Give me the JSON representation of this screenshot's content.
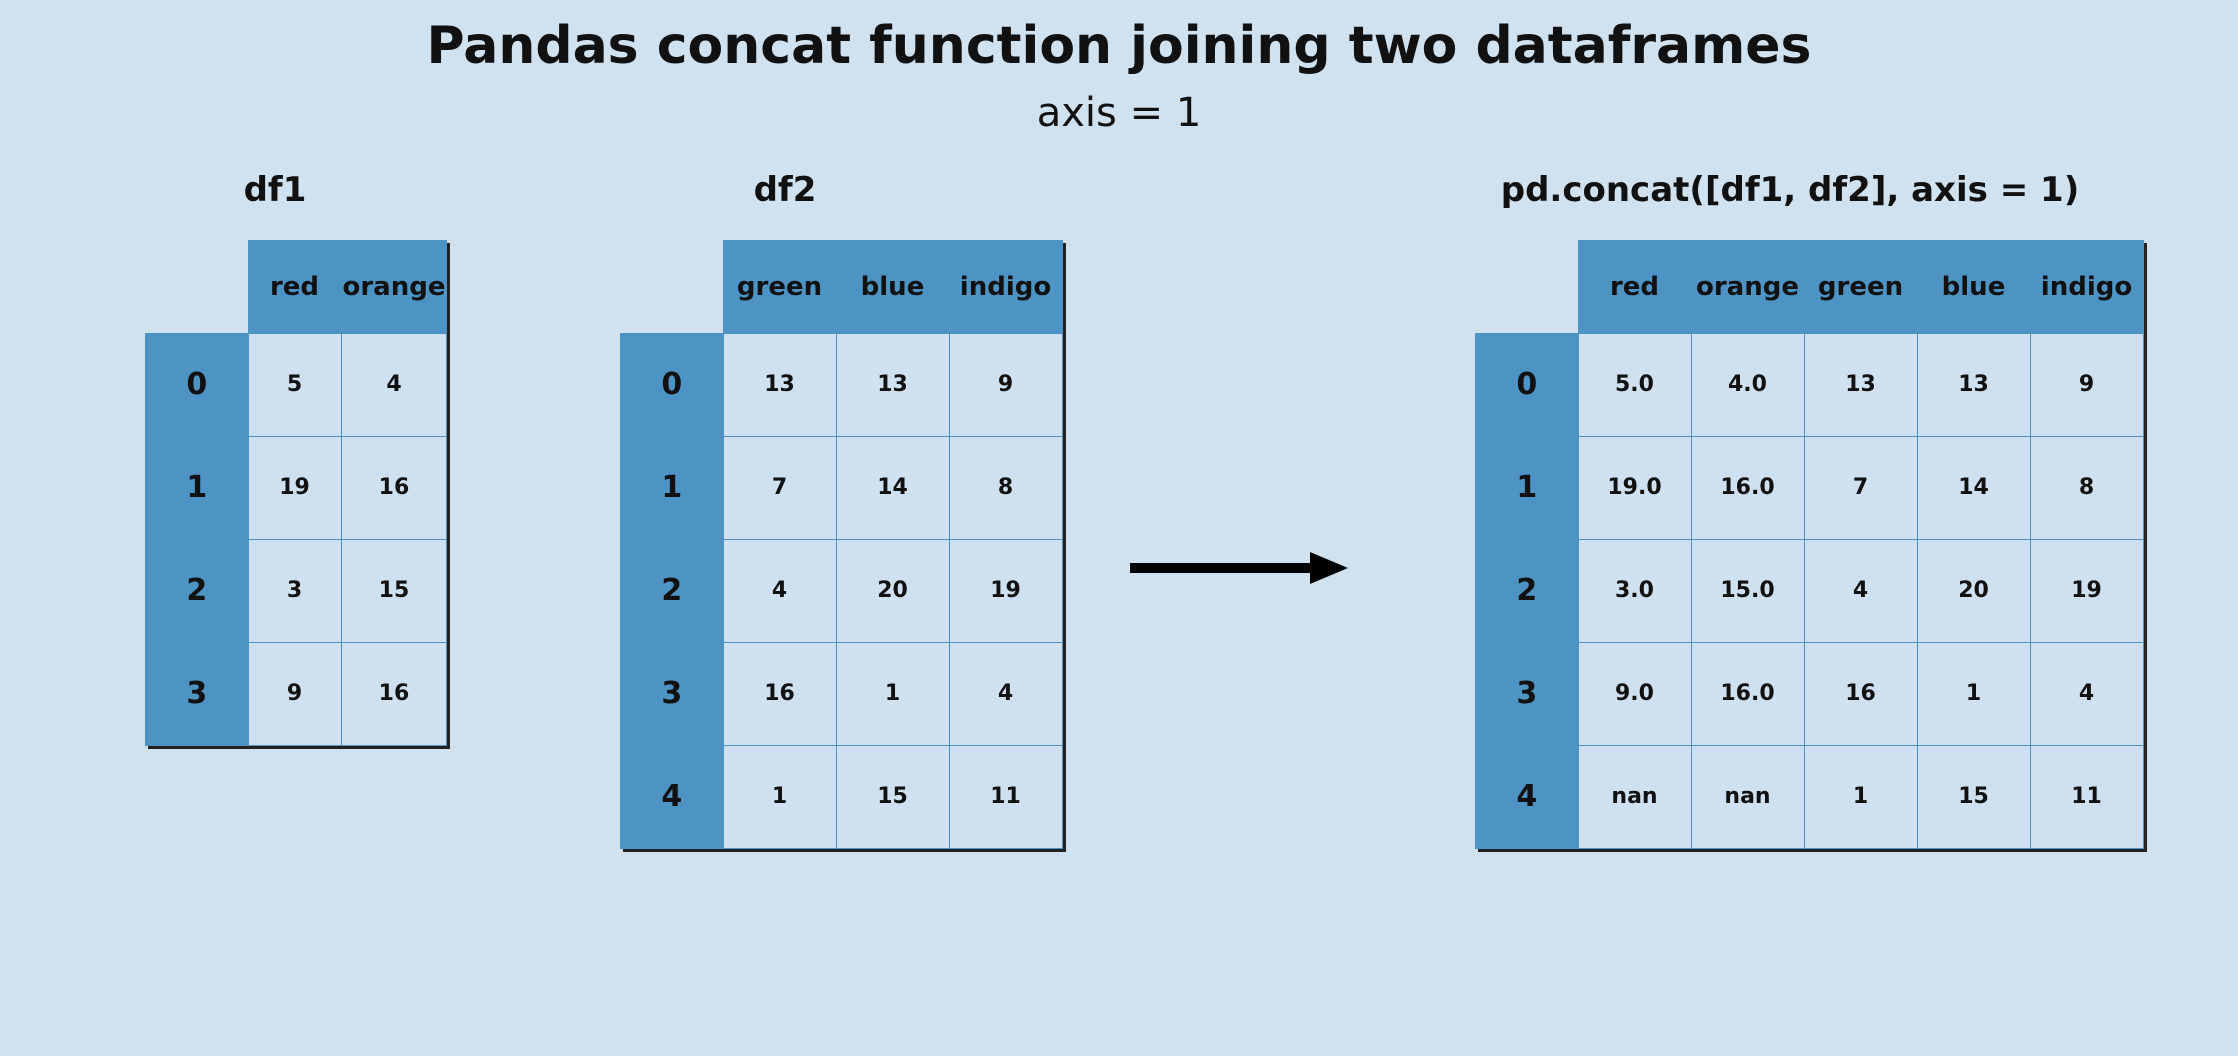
{
  "title": "Pandas concat function joining two dataframes",
  "subtitle": "axis = 1",
  "panels": {
    "df1": {
      "title": "df1"
    },
    "df2": {
      "title": "df2"
    },
    "result": {
      "title": "pd.concat([df1, df2], axis = 1)"
    }
  },
  "chart_data": [
    {
      "type": "table",
      "name": "df1",
      "columns": [
        "red",
        "orange"
      ],
      "index": [
        "0",
        "1",
        "2",
        "3"
      ],
      "values": [
        [
          "5",
          "4"
        ],
        [
          "19",
          "16"
        ],
        [
          "3",
          "15"
        ],
        [
          "9",
          "16"
        ]
      ]
    },
    {
      "type": "table",
      "name": "df2",
      "columns": [
        "green",
        "blue",
        "indigo"
      ],
      "index": [
        "0",
        "1",
        "2",
        "3",
        "4"
      ],
      "values": [
        [
          "13",
          "13",
          "9"
        ],
        [
          "7",
          "14",
          "8"
        ],
        [
          "4",
          "20",
          "19"
        ],
        [
          "16",
          "1",
          "4"
        ],
        [
          "1",
          "15",
          "11"
        ]
      ]
    },
    {
      "type": "table",
      "name": "result",
      "columns": [
        "red",
        "orange",
        "green",
        "blue",
        "indigo"
      ],
      "index": [
        "0",
        "1",
        "2",
        "3",
        "4"
      ],
      "values": [
        [
          "5.0",
          "4.0",
          "13",
          "13",
          "9"
        ],
        [
          "19.0",
          "16.0",
          "7",
          "14",
          "8"
        ],
        [
          "3.0",
          "15.0",
          "4",
          "20",
          "19"
        ],
        [
          "9.0",
          "16.0",
          "16",
          "1",
          "4"
        ],
        [
          "nan",
          "nan",
          "1",
          "15",
          "11"
        ]
      ]
    }
  ]
}
